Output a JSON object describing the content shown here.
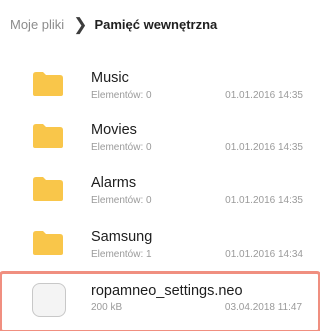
{
  "breadcrumb": {
    "root": "Moje pliki",
    "separator": "❯",
    "current": "Pamięć wewnętrzna"
  },
  "items": [
    {
      "name": "Music",
      "meta": "Elementów: 0",
      "date": "01.01.2016 14:35",
      "icon": "folder-icon"
    },
    {
      "name": "Movies",
      "meta": "Elementów: 0",
      "date": "01.01.2016 14:35",
      "icon": "folder-icon"
    },
    {
      "name": "Alarms",
      "meta": "Elementów: 0",
      "date": "01.01.2016 14:35",
      "icon": "folder-icon"
    },
    {
      "name": "Samsung",
      "meta": "Elementów: 1",
      "date": "01.01.2016 14:34",
      "icon": "folder-icon"
    },
    {
      "name": "ropamneo_settings.neo",
      "meta": "200 kB",
      "date": "03.04.2018 11:47",
      "icon": "file-icon"
    }
  ],
  "colors": {
    "folder": "#f9c64a",
    "highlight": "#f08f80"
  }
}
